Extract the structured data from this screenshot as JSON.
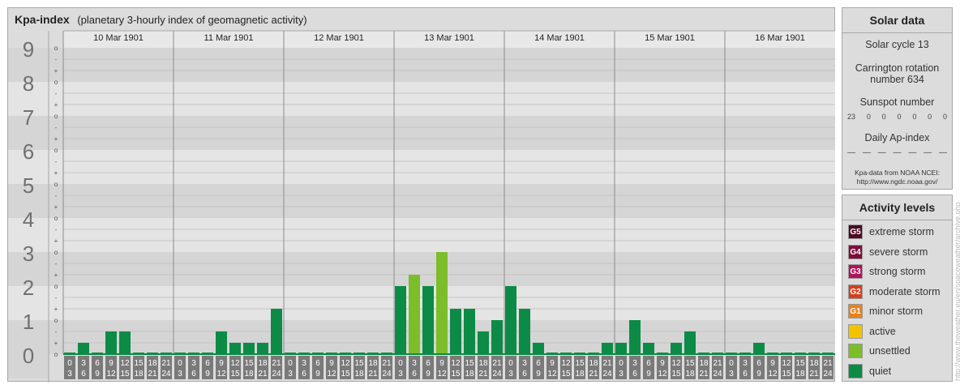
{
  "header": {
    "title": "Kpa-index",
    "subtitle": "(planetary 3-hourly index of geomagnetic activity)"
  },
  "chart_data": {
    "type": "bar",
    "title": "Kpa-index",
    "subtitle": "(planetary 3-hourly index of geomagnetic activity)",
    "ylim": [
      0,
      9
    ],
    "y_ticks": [
      "0",
      "1",
      "2",
      "3",
      "4",
      "5",
      "6",
      "7",
      "8",
      "9"
    ],
    "y_subticks": [
      "+",
      "-",
      "o"
    ],
    "days": [
      "10 Mar 1901",
      "11 Mar 1901",
      "12 Mar 1901",
      "13 Mar 1901",
      "14 Mar 1901",
      "15 Mar 1901",
      "16 Mar 1901"
    ],
    "interval_top": [
      "0",
      "3",
      "6",
      "9",
      "12",
      "15",
      "18",
      "21"
    ],
    "interval_bottom": [
      "3",
      "6",
      "9",
      "12",
      "15",
      "18",
      "21",
      "24"
    ],
    "values": [
      [
        0,
        0.333,
        0,
        0.667,
        0.667,
        0,
        0,
        0
      ],
      [
        0,
        0,
        0,
        0.667,
        0.333,
        0.333,
        0.333,
        1.333
      ],
      [
        0,
        0,
        0,
        0,
        0,
        0,
        0,
        0
      ],
      [
        2.0,
        2.333,
        2.0,
        3.0,
        1.333,
        1.333,
        0.667,
        1.0
      ],
      [
        2.0,
        1.333,
        0.333,
        0,
        0,
        0,
        0,
        0.333
      ],
      [
        0.333,
        1.0,
        0.333,
        0,
        0.333,
        0.667,
        0,
        0
      ],
      [
        0,
        0,
        0.333,
        0,
        0,
        0,
        0,
        0
      ]
    ],
    "levels": [
      {
        "name": "quiet",
        "max": 2,
        "color": "#0b8b45"
      },
      {
        "name": "unsettled",
        "max": 3,
        "color": "#7cbd2a"
      },
      {
        "name": "active",
        "max": 4,
        "color": "#f4c300"
      }
    ],
    "grid": true
  },
  "solar": {
    "heading": "Solar data",
    "cycle": "Solar cycle 13",
    "carrington_line1": "Carrington rotation",
    "carrington_line2": "number 634",
    "sunspot_label": "Sunspot number",
    "sunspot_values": [
      "23",
      "0",
      "0",
      "0",
      "0",
      "0",
      "0"
    ],
    "ap_label": "Daily Ap-index",
    "ap_values": [
      "—",
      "—",
      "—",
      "—",
      "—",
      "—",
      "—"
    ],
    "source_line1": "Kpa-data from NOAA NCEI:",
    "source_line2": "http://www.ngdc.noaa.gov/"
  },
  "activity": {
    "heading": "Activity levels",
    "items": [
      {
        "badge": "G5",
        "label": "extreme storm",
        "color": "#4a0a24"
      },
      {
        "badge": "G4",
        "label": "severe storm",
        "color": "#7a0e3a"
      },
      {
        "badge": "G3",
        "label": "strong storm",
        "color": "#b0145a"
      },
      {
        "badge": "G2",
        "label": "moderate storm",
        "color": "#d2411f"
      },
      {
        "badge": "G1",
        "label": "minor storm",
        "color": "#e8821c"
      },
      {
        "badge": "",
        "label": "active",
        "color": "#f4c300"
      },
      {
        "badge": "",
        "label": "unsettled",
        "color": "#7cbd2a"
      },
      {
        "badge": "",
        "label": "quiet",
        "color": "#0b8b45"
      }
    ]
  },
  "watermark": "http://www.theweather.eu/en/spaceweather/archive.php"
}
